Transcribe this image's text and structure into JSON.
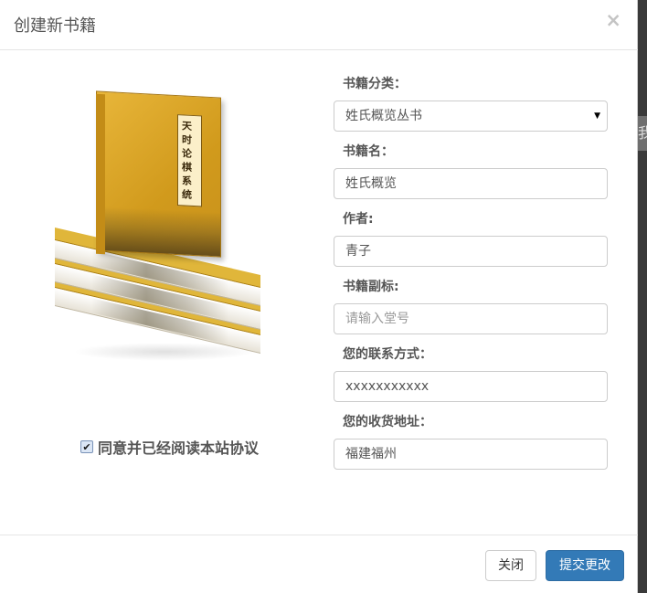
{
  "modal": {
    "title": "创建新书籍",
    "close_label": "×"
  },
  "book_image": {
    "cover_title": "天时论棋系统"
  },
  "agreement": {
    "checked": true,
    "check_glyph": "✔",
    "label": "同意并已经阅读本站协议"
  },
  "form": {
    "category": {
      "label": "书籍分类：",
      "value": "姓氏概览丛书"
    },
    "name": {
      "label": "书籍名：",
      "value": "姓氏概览"
    },
    "author": {
      "label": "作者:",
      "value": "青子"
    },
    "subtitle": {
      "label": "书籍副标:",
      "value": "",
      "placeholder": "请输入堂号"
    },
    "contact": {
      "label": "您的联系方式：",
      "value": "xxxxxxxxxxx"
    },
    "address": {
      "label": "您的收货地址：",
      "value": "福建福州"
    }
  },
  "footer": {
    "close_label": "关闭",
    "submit_label": "提交更改"
  },
  "colors": {
    "primary": "#337ab7",
    "cover": "#e0b63a"
  },
  "icons": {
    "select_arrow": "▼",
    "checkbox": "checkbox-checked-icon"
  },
  "background": {
    "tab_char": "我"
  }
}
